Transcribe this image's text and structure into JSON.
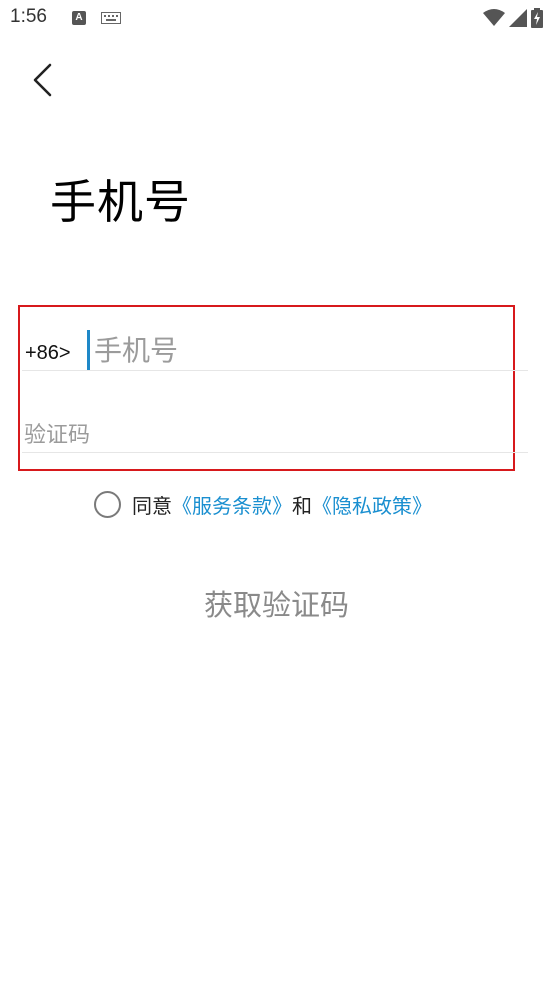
{
  "status_bar": {
    "time": "1:56",
    "notification_icon_letter": "A",
    "icons": [
      "a-notification-icon",
      "keyboard-icon",
      "wifi-icon",
      "signal-icon",
      "battery-charging-icon"
    ]
  },
  "nav": {
    "back_icon": "chevron-left-icon"
  },
  "title": "手机号",
  "form": {
    "country_code": "+86>",
    "phone_value": "",
    "phone_placeholder": "手机号",
    "code_value": "",
    "code_placeholder": "验证码"
  },
  "agreement": {
    "checked": false,
    "prefix": "同意",
    "terms_link": "《服务条款》",
    "conjunction": "和",
    "privacy_link": "《隐私政策》"
  },
  "actions": {
    "get_code_label": "获取验证码"
  },
  "colors": {
    "link": "#1a8fd0",
    "cursor": "#1e88c8",
    "highlight_border": "#d7191c",
    "disabled_button_text": "#8a8a8a"
  }
}
